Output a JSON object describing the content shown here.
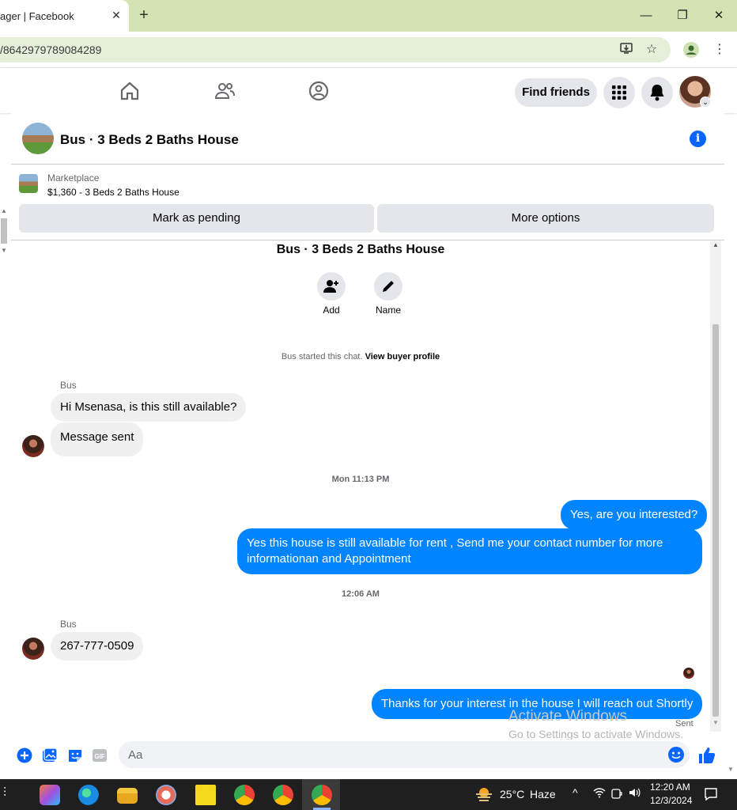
{
  "browser": {
    "tab_title": "ager | Facebook",
    "url": "/8642979789084289"
  },
  "nav": {
    "find_friends": "Find friends"
  },
  "conversation": {
    "title": "Bus · 3 Beds 2 Baths House"
  },
  "marketplace": {
    "label": "Marketplace",
    "item": "$1,360 - 3 Beds 2 Baths House",
    "mark_pending": "Mark as pending",
    "more_options": "More options"
  },
  "chat": {
    "title": "Bus · 3 Beds 2 Baths House",
    "add_label": "Add",
    "name_label": "Name",
    "system_prefix": "Bus started this chat.",
    "system_link": "View buyer profile",
    "sender1": "Bus",
    "msg1": "Hi Msenasa, is this still available?",
    "msg2": "Message sent",
    "time1": "Mon 11:13 PM",
    "msg3": "Yes, are you interested?",
    "msg4": "Yes this house is still available for rent , Send me your contact number for more informationan and Appointment",
    "time2": "12:06 AM",
    "sender2": "Bus",
    "msg5": "267-777-0509",
    "msg6": "Thanks for your interest in the house I will reach out Shortly",
    "sent_status": "Sent"
  },
  "watermark": {
    "line1": "Activate Windows",
    "line2": "Go to Settings to activate Windows."
  },
  "composer": {
    "placeholder": "Aa"
  },
  "taskbar": {
    "weather_temp": "25°C",
    "weather_desc": "Haze",
    "time": "12:20 AM",
    "date": "12/3/2024"
  },
  "colors": {
    "accent": "#0084ff",
    "fb_blue": "#0866ff",
    "tab_bg": "#d3e3b4"
  }
}
